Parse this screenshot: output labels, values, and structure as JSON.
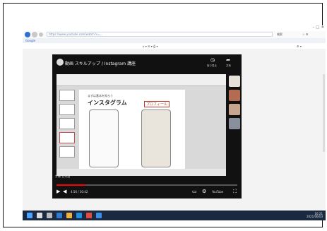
{
  "browser": {
    "url": "https://www.youtube.com/watch?v=...",
    "tab_title": "Google",
    "bookmark": "Google",
    "search_label": "検索"
  },
  "video": {
    "title": "動画 スキルアップ / Instagram 講座",
    "watch_later_label": "後で見る",
    "share_label": "共有",
    "slide_subtitle": "まずは基本を知ろう",
    "slide_title": "インスタグラム",
    "slide_callout": "プロフィール",
    "caption_text": "字幕 日本語",
    "time": "4:56 / 30:42",
    "progress": 0.16,
    "brand": "YouTube"
  },
  "taskbar": {
    "time": "16:21",
    "date": "2021/06/03"
  },
  "colors": {
    "accent": "#ff0000",
    "taskbar": "#1b2940"
  }
}
